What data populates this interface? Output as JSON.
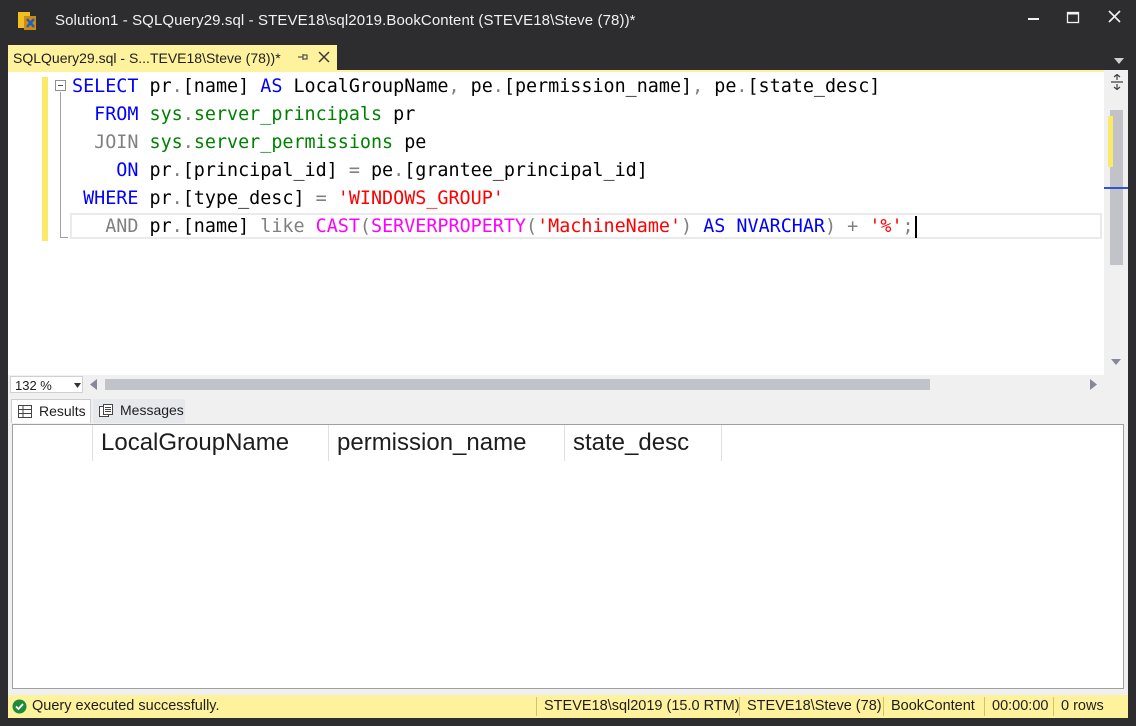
{
  "window": {
    "title": "Solution1 - SQLQuery29.sql - STEVE18\\sql2019.BookContent (STEVE18\\Steve (78))*"
  },
  "tab": {
    "label": "SQLQuery29.sql - S...TEVE18\\Steve (78))*"
  },
  "editor": {
    "zoom": "132 %",
    "lines": [
      [
        {
          "t": "SELECT",
          "c": "kw"
        },
        {
          "t": " pr",
          "c": ""
        },
        {
          "t": ".",
          "c": "gr"
        },
        {
          "t": "[name] ",
          "c": ""
        },
        {
          "t": "AS",
          "c": "kw"
        },
        {
          "t": " LocalGroupName",
          "c": ""
        },
        {
          "t": ",",
          "c": "gr"
        },
        {
          "t": " pe",
          "c": ""
        },
        {
          "t": ".",
          "c": "gr"
        },
        {
          "t": "[permission_name]",
          "c": ""
        },
        {
          "t": ",",
          "c": "gr"
        },
        {
          "t": " pe",
          "c": ""
        },
        {
          "t": ".",
          "c": "gr"
        },
        {
          "t": "[state_desc]",
          "c": ""
        }
      ],
      [
        {
          "t": "  FROM",
          "c": "kw"
        },
        {
          "t": " ",
          "c": ""
        },
        {
          "t": "sys",
          "c": "sy"
        },
        {
          "t": ".",
          "c": "gr"
        },
        {
          "t": "server_principals",
          "c": "sy"
        },
        {
          "t": " pr",
          "c": ""
        }
      ],
      [
        {
          "t": "  JOIN",
          "c": "gr"
        },
        {
          "t": " ",
          "c": ""
        },
        {
          "t": "sys",
          "c": "sy"
        },
        {
          "t": ".",
          "c": "gr"
        },
        {
          "t": "server_permissions",
          "c": "sy"
        },
        {
          "t": " pe",
          "c": ""
        }
      ],
      [
        {
          "t": "    ON",
          "c": "kw"
        },
        {
          "t": " pr",
          "c": ""
        },
        {
          "t": ".",
          "c": "gr"
        },
        {
          "t": "[principal_id] ",
          "c": ""
        },
        {
          "t": "=",
          "c": "gr"
        },
        {
          "t": " pe",
          "c": ""
        },
        {
          "t": ".",
          "c": "gr"
        },
        {
          "t": "[grantee_principal_id]",
          "c": ""
        }
      ],
      [
        {
          "t": " WHERE",
          "c": "kw"
        },
        {
          "t": " pr",
          "c": ""
        },
        {
          "t": ".",
          "c": "gr"
        },
        {
          "t": "[type_desc] ",
          "c": ""
        },
        {
          "t": "=",
          "c": "gr"
        },
        {
          "t": " ",
          "c": ""
        },
        {
          "t": "'WINDOWS_GROUP'",
          "c": "st"
        }
      ],
      [
        {
          "t": "   AND",
          "c": "gr"
        },
        {
          "t": " pr",
          "c": ""
        },
        {
          "t": ".",
          "c": "gr"
        },
        {
          "t": "[name] ",
          "c": ""
        },
        {
          "t": "like",
          "c": "gr"
        },
        {
          "t": " ",
          "c": ""
        },
        {
          "t": "CAST",
          "c": "fn"
        },
        {
          "t": "(",
          "c": "gr"
        },
        {
          "t": "SERVERPROPERTY",
          "c": "fn"
        },
        {
          "t": "(",
          "c": "gr"
        },
        {
          "t": "'MachineName'",
          "c": "st"
        },
        {
          "t": ")",
          "c": "gr"
        },
        {
          "t": " ",
          "c": ""
        },
        {
          "t": "AS",
          "c": "kw"
        },
        {
          "t": " ",
          "c": ""
        },
        {
          "t": "NVARCHAR",
          "c": "kw"
        },
        {
          "t": ")",
          "c": "gr"
        },
        {
          "t": " ",
          "c": ""
        },
        {
          "t": "+",
          "c": "gr"
        },
        {
          "t": " ",
          "c": ""
        },
        {
          "t": "'%'",
          "c": "st"
        },
        {
          "t": ";",
          "c": "gr"
        }
      ]
    ]
  },
  "results": {
    "tabs": {
      "results": "Results",
      "messages": "Messages"
    },
    "columns": [
      "LocalGroupName",
      "permission_name",
      "state_desc"
    ]
  },
  "status": {
    "message": "Query executed successfully.",
    "server": "STEVE18\\sql2019 (15.0 RTM)",
    "user": "STEVE18\\Steve (78)",
    "database": "BookContent",
    "elapsed": "00:00:00",
    "rows": "0 rows"
  },
  "colors": {
    "tab_active": "#fff29d",
    "keyword": "#0000ff",
    "system_object": "#008000",
    "string": "#ff0000",
    "function": "#ff00ff",
    "operator": "#808080"
  },
  "icons": [
    "app-icon",
    "minimize-icon",
    "maximize-icon",
    "close-icon",
    "pin-icon",
    "tab-close-icon",
    "split-icon",
    "grid-icon",
    "messages-icon",
    "success-check-icon"
  ]
}
